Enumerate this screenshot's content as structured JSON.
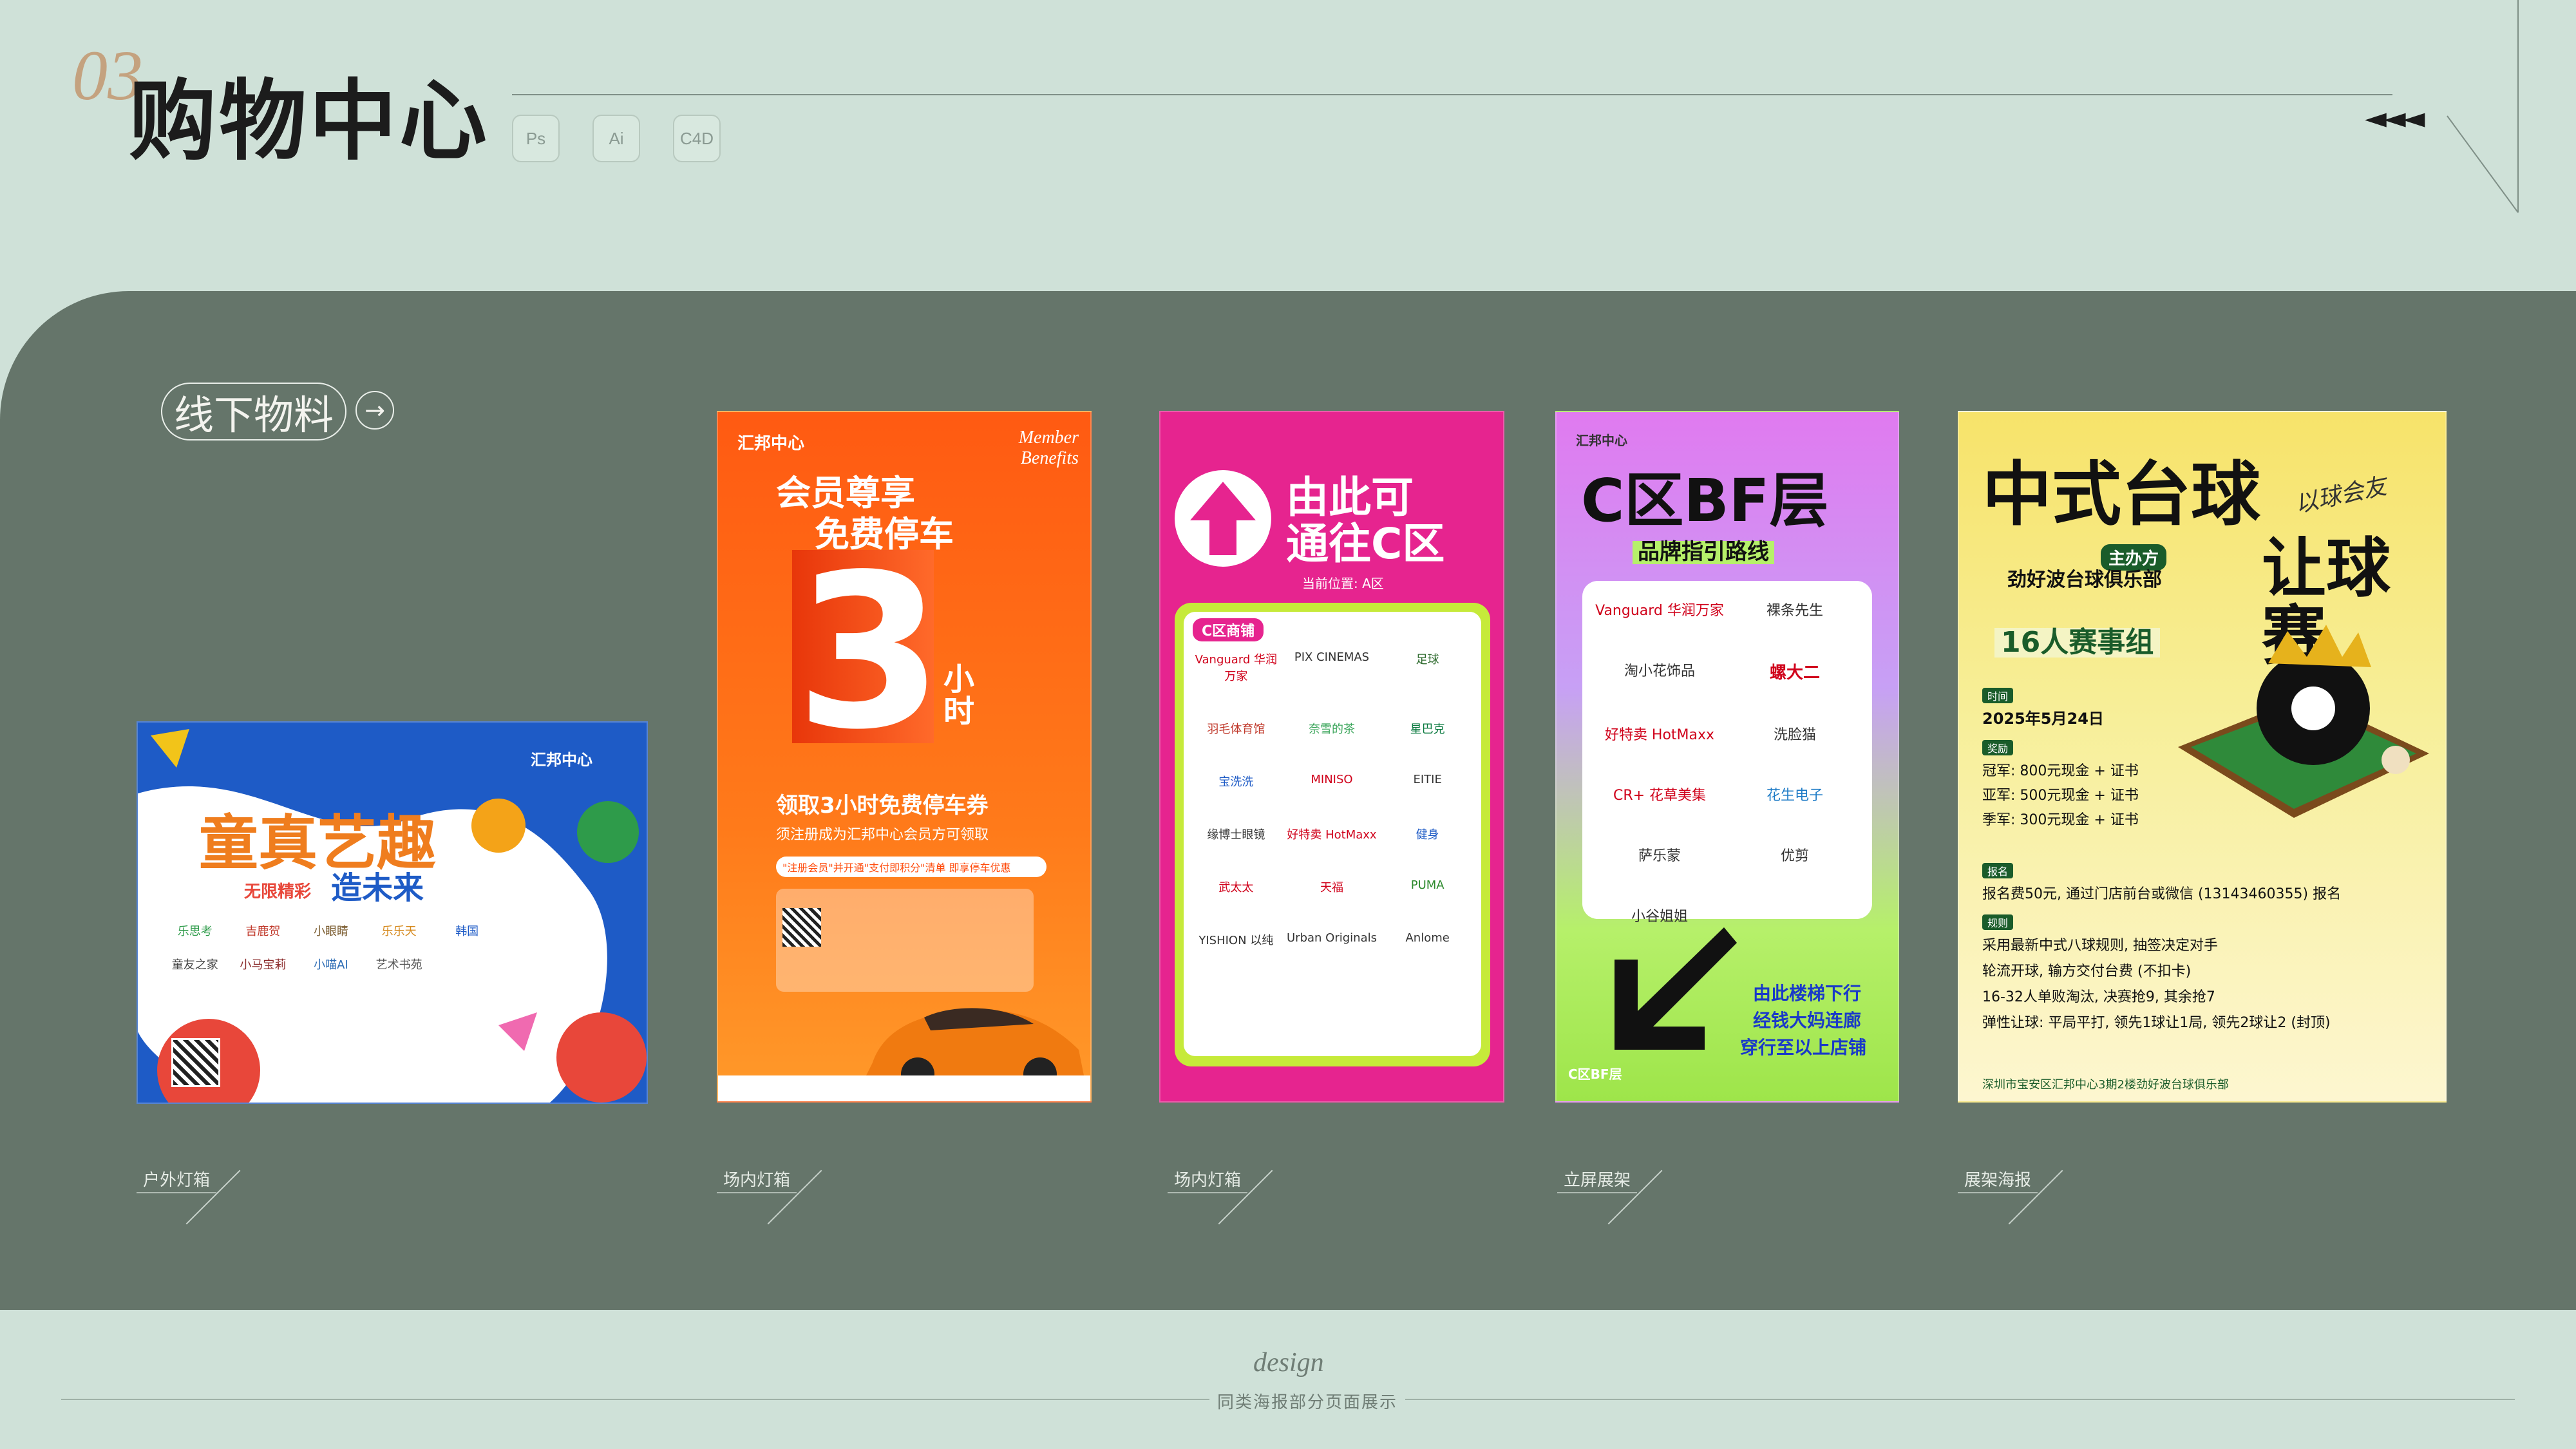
{
  "header": {
    "section_number": "03",
    "title": "购物中心",
    "tools": [
      "Ps",
      "Ai",
      "C4D"
    ]
  },
  "section": {
    "tag": "线下物料",
    "arrow": "→"
  },
  "posters": [
    {
      "label": "户外灯箱",
      "brand": "汇邦中心",
      "headline": "童真艺趣",
      "tagline_a": "无限精彩",
      "tagline_b": "造未来",
      "logos": [
        "乐思考",
        "吉鹿贺",
        "小眼睛",
        "乐乐天",
        "韩国",
        "童友之家",
        "小马宝莉",
        "小喵AI",
        "艺术书苑"
      ]
    },
    {
      "label": "场内灯箱",
      "brand": "汇邦中心",
      "corner": "Member Benefits",
      "line1": "会员尊享",
      "line2": "免费停车",
      "big_num": "3",
      "unit": "小时",
      "sub1": "领取3小时免费停车券",
      "sub2": "须注册成为汇邦中心会员方可领取",
      "sub3": "\"注册会员\"并开通\"支付即积分\"清单 即享停车优惠"
    },
    {
      "label": "场内灯箱",
      "line1": "由此可",
      "line2": "通往C区",
      "location": "当前位置: A区",
      "section_title": "C区商铺",
      "shops": [
        "Vanguard 华润万家",
        "PIX CINEMAS",
        "足球",
        "羽毛体育馆",
        "奈雪的茶",
        "星巴克",
        "宝洗洗",
        "MINISO",
        "EITIE",
        "缘博士眼镜",
        "好特卖 HotMaxx",
        "健身",
        "武太太",
        "天福",
        "PUMA",
        "YISHION 以纯",
        "Urban Originals",
        "Anlome"
      ]
    },
    {
      "label": "立屏展架",
      "brand": "汇邦中心",
      "title": "C区BF层",
      "subtitle": "品牌指引路线",
      "shops": [
        "Vanguard 华润万家",
        "裸条先生",
        "淘小花饰品",
        "螺大二",
        "好特卖 HotMaxx",
        "洗脸猫",
        "CR+ 花草美集",
        "花生电子",
        "萨乐蒙",
        "优剪",
        "小谷姐姐"
      ],
      "direction1": "由此楼梯下行",
      "direction2": "经钱大妈连廊",
      "direction3": "穿行至以上店铺",
      "floor_tag": "C区BF层"
    },
    {
      "label": "展架海报",
      "title1": "中式台球",
      "title2": "让球赛",
      "script": "以球会友",
      "host_label": "主办方",
      "host": "劲好波台球俱乐部",
      "group": "16人赛事组",
      "time_label": "时间",
      "date": "2025年5月24日",
      "prize_label": "奖励",
      "prizes": [
        "冠军: 800元现金 + 证书",
        "亚军: 500元现金 + 证书",
        "季军: 300元现金 + 证书"
      ],
      "signup_label": "报名",
      "signup": "报名费50元, 通过门店前台或微信 (13143460355) 报名",
      "rules_label": "规则",
      "rules": [
        "采用最新中式八球规则, 抽签决定对手",
        "轮流开球, 输方交付台费 (不扣卡)",
        "16-32人单败淘汰, 决赛抢9, 其余抢7",
        "弹性让球: 平局平打, 领先1球让1局, 领先2球让2 (封顶)"
      ],
      "address": "深圳市宝安区汇邦中心3期2楼劲好波台球俱乐部"
    }
  ],
  "footer": {
    "design": "design",
    "subtitle": "同类海报部分页面展示"
  },
  "colors": {
    "bg": "#cfe1d8",
    "panel": "#65756a",
    "accent_gold": "#c4a27f"
  }
}
